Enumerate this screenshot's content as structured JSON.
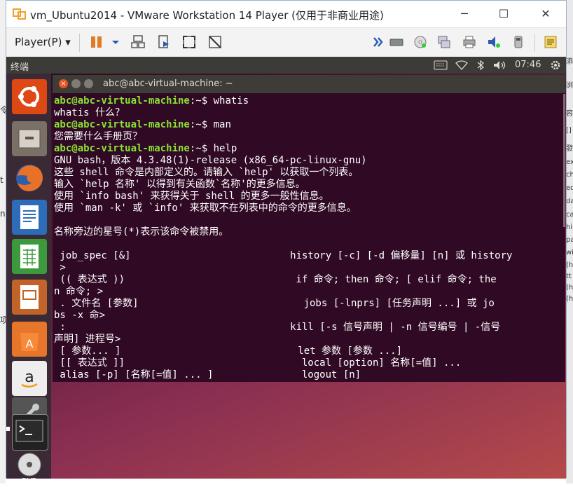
{
  "window": {
    "title": "vm_Ubuntu2014 - VMware Workstation 14 Player (仅用于非商业用途)",
    "minimize": "─",
    "maximize": "☐",
    "close": "✕"
  },
  "toolbar": {
    "player_menu": "Player(P) ▾"
  },
  "ubuntu_panel": {
    "title": "终端",
    "time": "07:46"
  },
  "terminal": {
    "title": "abc@abc-virtual-machine: ~",
    "prompt_user": "abc@abc-virtual-machine",
    "prompt_suffix": ":~$ ",
    "cmd1": "whatis",
    "out1": "whatis 什么？",
    "cmd2": "man",
    "out2": "您需要什么手册页？",
    "cmd3": "help",
    "lines": [
      "GNU bash，版本 4.3.48(1)-release (x86_64-pc-linux-gnu)",
      "这些 shell 命令是内部定义的。请输入 `help' 以获取一个列表。",
      "输入 `help 名称' 以得到有关函数`名称'的更多信息。",
      "使用 `info bash' 来获得关于 shell 的更多一般性信息。",
      "使用 `man -k' 或 `info' 来获取不在列表中的命令的更多信息。",
      "",
      "名称旁边的星号(*)表示该命令被禁用。",
      "",
      " job_spec [&]                           history [-c] [-d 偏移量] [n] 或 history",
      " >",
      " (( 表达式 ))                             if 命令; then 命令; [ elif 命令; the",
      "n 命令; >",
      " . 文件名 [参数]                            jobs [-lnprs] [任务声明 ...] 或 jo",
      "bs -x 命>",
      " :                                      kill [-s 信号声明 | -n 信号编号 | -信号",
      "声明] 进程号>",
      " [ 参数... ]                              let 参数 [参数 ...]",
      " [[ 表达式 ]]                              local [option] 名称[=值] ...",
      " alias [-p] [名称[=值] ... ]               logout [n]"
    ]
  },
  "host_side": {
    "left_chars": [
      "令",
      "t",
      "n",
      "项"
    ],
    "right_chars": [
      "添",
      "浏",
      "容",
      "[]",
      "發",
      "ex",
      "ch",
      "ed",
      "da",
      "ca",
      "hi",
      "pa",
      "wi",
      "(h",
      "tt",
      "(h",
      "(h"
    ]
  }
}
